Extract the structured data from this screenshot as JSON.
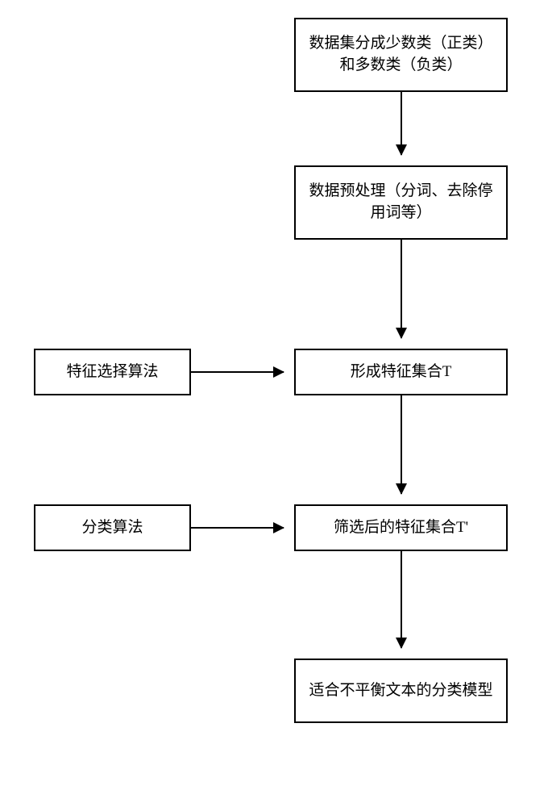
{
  "boxes": {
    "step1": "数据集分成少数类（正类）和多数类（负类）",
    "step2": "数据预处理（分词、去除停用词等）",
    "step3": "形成特征集合T",
    "left3": "特征选择算法",
    "step4": "筛选后的特征集合T'",
    "left4": "分类算法",
    "step5": "适合不平衡文本的分类模型"
  }
}
